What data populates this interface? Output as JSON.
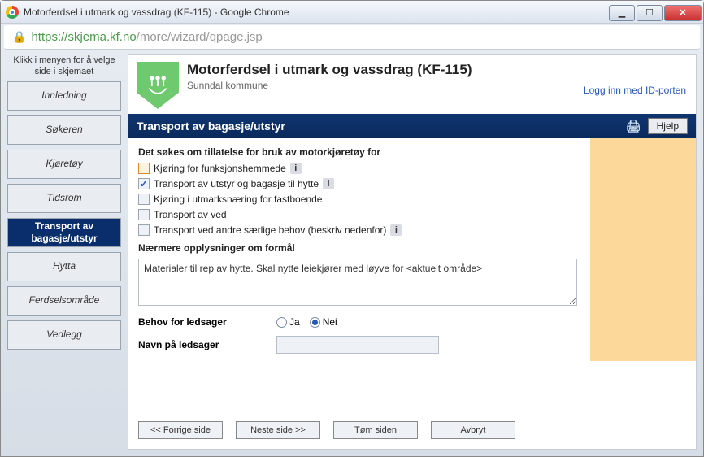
{
  "window": {
    "title": "Motorferdsel i utmark og vassdrag (KF-115) - Google Chrome"
  },
  "url": {
    "host": "https://skjema.kf.no",
    "path": "/more/wizard/qpage.jsp"
  },
  "sidebar": {
    "hint": "Klikk i menyen for å velge side i skjemaet",
    "items": [
      {
        "label": "Innledning",
        "active": false
      },
      {
        "label": "Søkeren",
        "active": false
      },
      {
        "label": "Kjøretøy",
        "active": false
      },
      {
        "label": "Tidsrom",
        "active": false
      },
      {
        "label": "Transport av bagasje/utstyr",
        "active": true
      },
      {
        "label": "Hytta",
        "active": false
      },
      {
        "label": "Ferdselsområde",
        "active": false
      },
      {
        "label": "Vedlegg",
        "active": false
      }
    ]
  },
  "header": {
    "title": "Motorferdsel i utmark og vassdrag (KF-115)",
    "subtitle": "Sunndal kommune",
    "login": "Logg inn med ID-porten"
  },
  "section": {
    "title": "Transport av bagasje/utstyr",
    "help": "Hjelp"
  },
  "form": {
    "group1_label": "Det søkes om tillatelse for bruk av motorkjøretøy for",
    "chk": {
      "funksjon": "Kjøring for funksjonshemmede",
      "transport_hytte": "Transport av utstyr og bagasje til hytte",
      "utmark": "Kjøring i utmarksnæring for fastboende",
      "ved": "Transport av ved",
      "saerlige": "Transport ved andre særlige behov (beskriv nedenfor)"
    },
    "details_label": "Nærmere opplysninger om formål",
    "details_value": "Materialer til rep av hytte. Skal nytte leiekjører med løyve for <aktuelt område>",
    "ledsager_label": "Behov for ledsager",
    "ja": "Ja",
    "nei": "Nei",
    "navn_label": "Navn på ledsager",
    "navn_value": ""
  },
  "buttons": {
    "prev": "<< Forrige side",
    "next": "Neste side >>",
    "clear": "Tøm siden",
    "cancel": "Avbryt"
  }
}
